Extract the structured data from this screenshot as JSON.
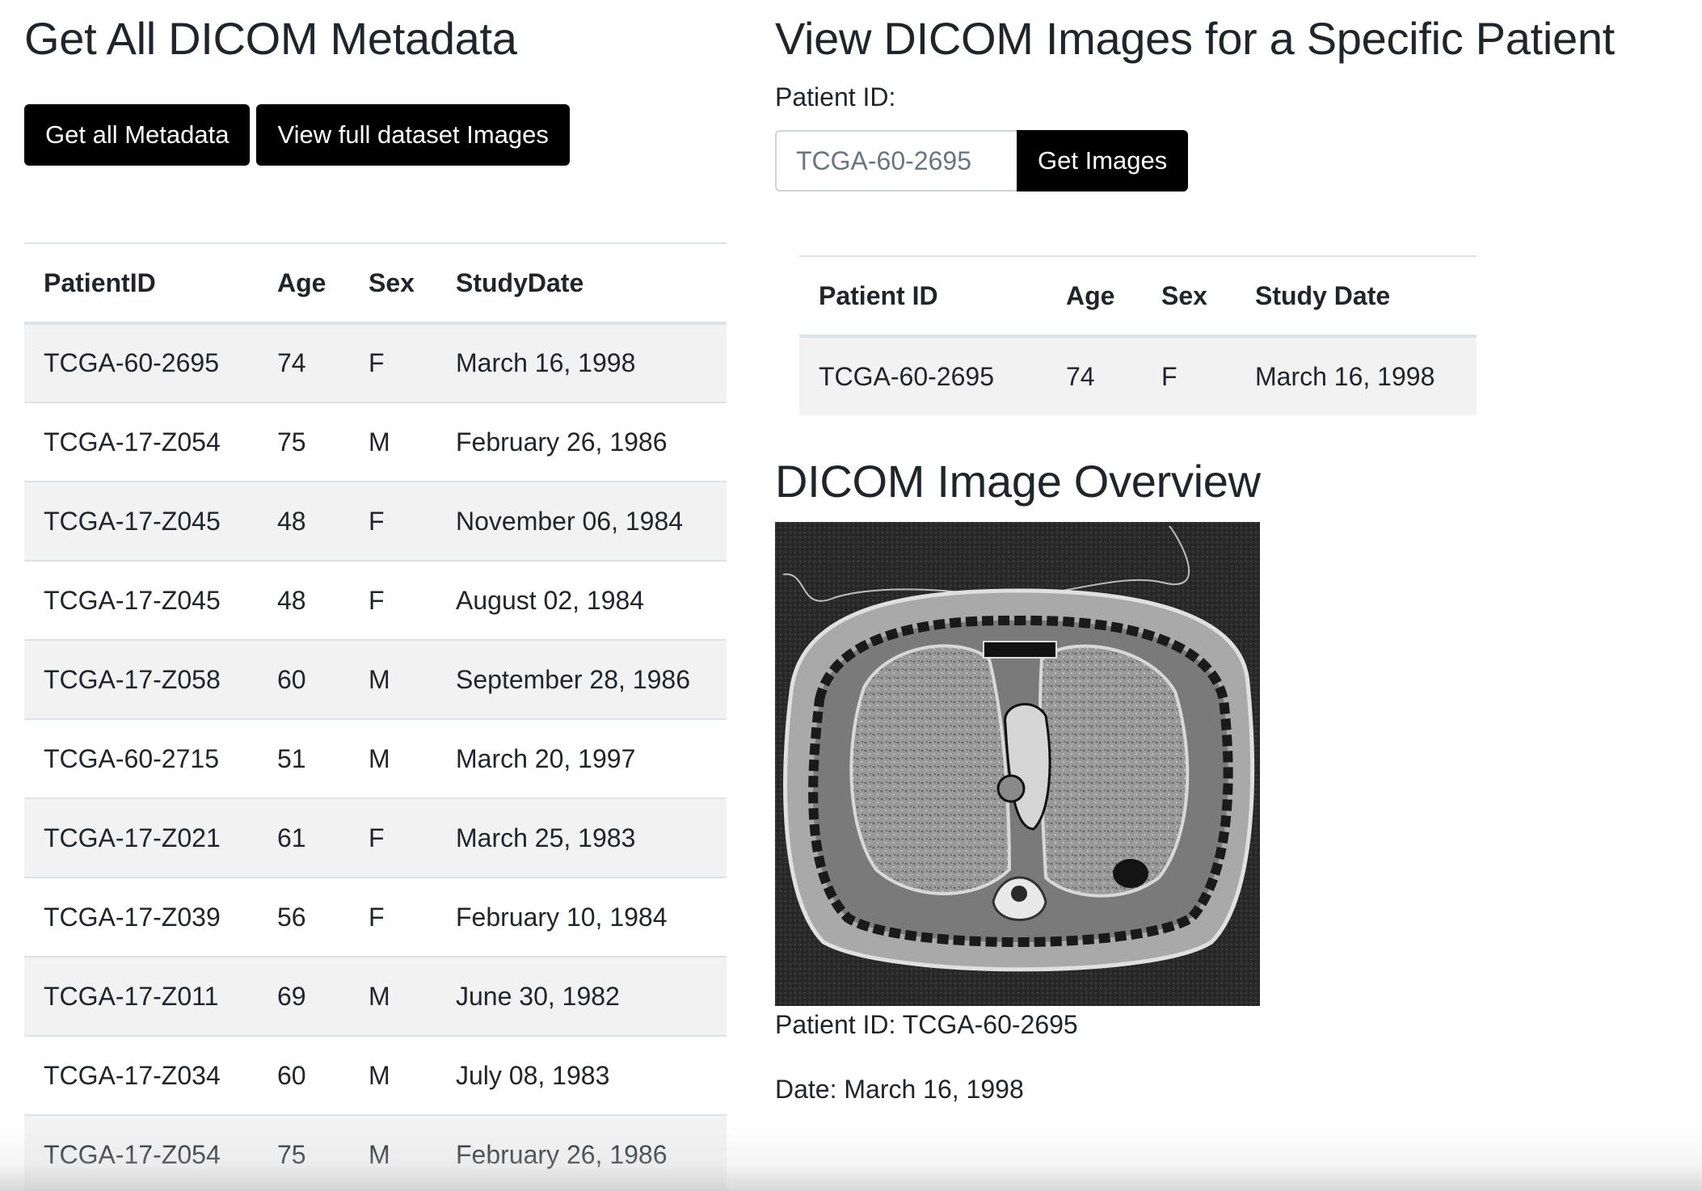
{
  "metadata_section": {
    "title": "Get All DICOM Metadata",
    "get_all_label": "Get all Metadata",
    "view_full_label": "View full dataset Images",
    "columns": [
      "PatientID",
      "Age",
      "Sex",
      "StudyDate"
    ],
    "rows": [
      [
        "TCGA-60-2695",
        "74",
        "F",
        "March 16, 1998"
      ],
      [
        "TCGA-17-Z054",
        "75",
        "M",
        "February 26, 1986"
      ],
      [
        "TCGA-17-Z045",
        "48",
        "F",
        "November 06, 1984"
      ],
      [
        "TCGA-17-Z045",
        "48",
        "F",
        "August 02, 1984"
      ],
      [
        "TCGA-17-Z058",
        "60",
        "M",
        "September 28, 1986"
      ],
      [
        "TCGA-60-2715",
        "51",
        "M",
        "March 20, 1997"
      ],
      [
        "TCGA-17-Z021",
        "61",
        "F",
        "March 25, 1983"
      ],
      [
        "TCGA-17-Z039",
        "56",
        "F",
        "February 10, 1984"
      ],
      [
        "TCGA-17-Z011",
        "69",
        "M",
        "June 30, 1982"
      ],
      [
        "TCGA-17-Z034",
        "60",
        "M",
        "July 08, 1983"
      ],
      [
        "TCGA-17-Z054",
        "75",
        "M",
        "February 26, 1986"
      ]
    ]
  },
  "patient_section": {
    "title": "View DICOM Images for a Specific Patient",
    "patient_id_label": "Patient ID:",
    "patient_id_value": "TCGA-60-2695",
    "get_images_label": "Get Images",
    "columns": [
      "Patient ID",
      "Age",
      "Sex",
      "Study Date"
    ],
    "row": [
      "TCGA-60-2695",
      "74",
      "F",
      "March 16, 1998"
    ]
  },
  "overview": {
    "title": "DICOM Image Overview",
    "patient_caption": "Patient ID: TCGA-60-2695",
    "date_caption": "Date: March 16, 1998"
  }
}
